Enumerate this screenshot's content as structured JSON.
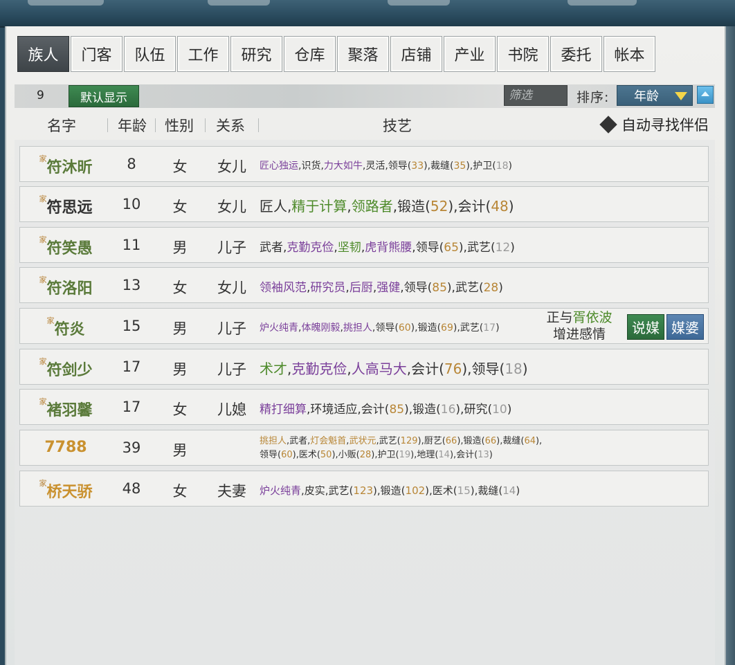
{
  "tabs": [
    "族人",
    "门客",
    "队伍",
    "工作",
    "研究",
    "仓库",
    "聚落",
    "店铺",
    "产业",
    "书院",
    "委托",
    "帐本"
  ],
  "filterbar": {
    "count": "9",
    "default_label": "默认显示",
    "filter_placeholder": "筛选",
    "sort_label": "排序:",
    "sort_value": "年龄"
  },
  "header": {
    "name": "名字",
    "age": "年龄",
    "sex": "性别",
    "relation": "关系",
    "skills": "技艺",
    "auto_find": "自动寻找伴侣"
  },
  "family_tag": "家",
  "rows": [
    {
      "name": "符沐昕",
      "age": "8",
      "sex": "女",
      "rel": "女儿",
      "s": [
        "匠心独运",
        ",识货,",
        "力大如牛",
        ",灵活,领导(",
        "33",
        "),裁缝(",
        "35",
        "),护卫(",
        "18",
        ")"
      ]
    },
    {
      "name": "符思远",
      "age": "10",
      "sex": "女",
      "rel": "女儿",
      "s": [
        "匠人,",
        "精于计算",
        ",",
        "领路者",
        ",锻造(",
        "52",
        "),会计(",
        "48",
        ")"
      ]
    },
    {
      "name": "符笑愚",
      "age": "11",
      "sex": "男",
      "rel": "儿子",
      "s": [
        "武者,",
        "克勤克俭",
        ",",
        "坚韧",
        ",",
        "虎背熊腰",
        ",领导(",
        "65",
        "),武艺(",
        "12",
        ")"
      ]
    },
    {
      "name": "符洛阳",
      "age": "13",
      "sex": "女",
      "rel": "女儿",
      "s": [
        "领袖风范",
        ",",
        "研究员",
        ",",
        "后厨",
        ",",
        "强健",
        ",领导(",
        "85",
        "),武艺(",
        "28",
        ")"
      ]
    },
    {
      "name": "符炎",
      "age": "15",
      "sex": "男",
      "rel": "儿子",
      "s": [
        "炉火纯青",
        ",",
        "体魄刚毅",
        ",",
        "挑担人",
        ",领导(",
        "60",
        "),锻造(",
        "69",
        "),武艺(",
        "17",
        ")"
      ],
      "romance_prefix": "正与",
      "romance_partner": "胥依波",
      "romance_suffix": "增进感情",
      "btn_match": "说媒",
      "btn_matchmaker": "媒婆"
    },
    {
      "name": "符剑少",
      "age": "17",
      "sex": "男",
      "rel": "儿子",
      "s": [
        "术才",
        ",",
        "克勤克俭",
        ",",
        "人高马大",
        ",会计(",
        "76",
        "),领导(",
        "18",
        ")"
      ]
    },
    {
      "name": "褚羽馨",
      "age": "17",
      "sex": "女",
      "rel": "儿媳",
      "s": [
        "精打细算",
        ",环境适应,会计(",
        "85",
        "),锻造(",
        "16",
        "),研究(",
        "10",
        ")"
      ]
    },
    {
      "name": "7788",
      "age": "39",
      "sex": "男",
      "rel": "",
      "s": [
        "挑担人",
        ",武者,",
        "灯会魁首",
        ",",
        "武状元",
        ",武艺(",
        "129",
        "),厨艺(",
        "66",
        "),锻造(",
        "66",
        "),裁缝(",
        "64",
        "),领导(",
        "60",
        "),医术(",
        "50",
        "),小贩(",
        "28",
        "),护卫(",
        "19",
        "),地理(",
        "14",
        "),会计(",
        "13",
        ")"
      ]
    },
    {
      "name": "桥天骄",
      "age": "48",
      "sex": "女",
      "rel": "夫妻",
      "s": [
        "炉火纯青",
        ",皮实,武艺(",
        "123",
        "),锻造(",
        "102",
        "),医术(",
        "15",
        "),裁缝(",
        "14",
        ")"
      ]
    }
  ]
}
